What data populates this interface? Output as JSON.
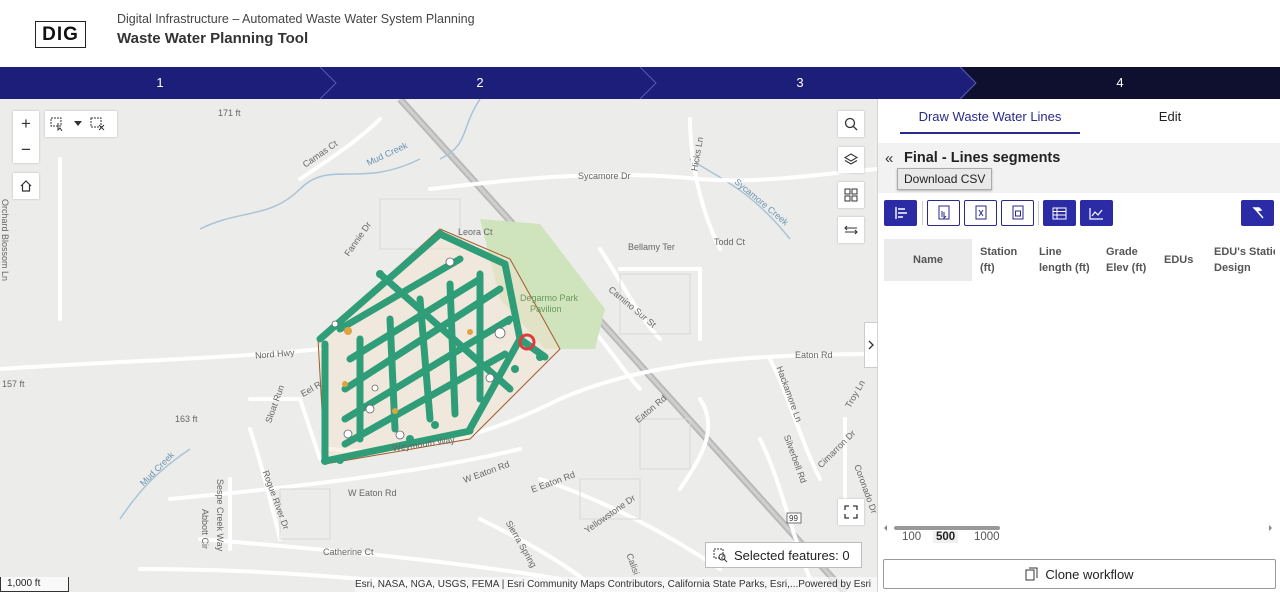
{
  "header": {
    "logo_text": "DIG",
    "subtitle": "Digital Infrastructure – Automated Waste Water System Planning",
    "title": "Waste Water Planning Tool"
  },
  "stepper": {
    "steps": [
      "1",
      "2",
      "3",
      "4"
    ],
    "active_step": "4",
    "colors": {
      "inactive": "#1d1d7a",
      "active": "#0f0f30"
    }
  },
  "map": {
    "zoom_in": "+",
    "zoom_out": "−",
    "labels": {
      "elev_171": "171 ft",
      "elev_157": "157 ft",
      "elev_163": "163 ft",
      "camas_ct": "Camas Ct",
      "mud_creek_1": "Mud Creek",
      "mud_creek_2": "Mud Creek",
      "orchard": "Orchard Blossom Ln",
      "fannie": "Fannie Dr",
      "leora": "Leora Ct",
      "sycamore_dr": "Sycamore Dr",
      "hicks": "Hicks Ln",
      "sycamore_creek": "Sycamore Creek",
      "bellamy": "Bellamy Ter",
      "todd": "Todd Ct",
      "degarmo": "Degarmo Park",
      "pavilion": "Pavilion",
      "camino": "Camino Sur St",
      "nord": "Nord Hwy",
      "eel": "Eel R",
      "sloat": "Sloat Run",
      "eaton_rd_e": "Eaton Rd",
      "hackamore": "Hackamore Ln",
      "troy": "Troy Ln",
      "eaton_rd_mid": "Eaton Rd",
      "weymouth": "Weymouth Way",
      "sespe": "Sespe Creek Way",
      "rogue": "Rogue River Dr",
      "abbott": "Abbott Cir",
      "w_eaton_rd": "W Eaton Rd",
      "w_eaton_rd_2": "W Eaton Rd",
      "e_eaton_rd": "E Eaton Rd",
      "silverbell": "Silverbell Rd",
      "cimarron": "Cimarron Dr",
      "coronado": "Coronado Dr",
      "yellowstone": "Yellowstone Dr",
      "sierra": "Sierra Spring",
      "calisi": "Calisi",
      "catherine": "Catherine Ct",
      "hwy99": "99"
    },
    "selected_features": "Selected features: 0",
    "attribution": "Esri, NASA, NGA, USGS, FEMA | Esri Community Maps Contributors, California State Parks, Esri,...",
    "powered_by": "Powered by Esri",
    "scale": "1,000 ft",
    "colors": {
      "network": "#2f9e78",
      "park": "#cfe3bd",
      "base": "#ececea",
      "highlight": "#e03a3a"
    }
  },
  "panel": {
    "tabs": [
      "Draw Waste Water Lines",
      "Edit"
    ],
    "section_title": "Final - Lines segments",
    "tooltip": "Download CSV",
    "table_headers": [
      {
        "line1": "Name",
        "line2": ""
      },
      {
        "line1": "Station",
        "line2": "(ft)"
      },
      {
        "line1": "Line",
        "line2": "length (ft)"
      },
      {
        "line1": "Grade",
        "line2": "Elev (ft)"
      },
      {
        "line1": "EDUs",
        "line2": ""
      },
      {
        "line1": "EDU's Static",
        "line2": "Design"
      }
    ],
    "page_sizes": [
      "100",
      "500",
      "1000"
    ],
    "selected_page_size": "500",
    "clone_button": "Clone workflow",
    "accent": "#2b2ba6"
  }
}
